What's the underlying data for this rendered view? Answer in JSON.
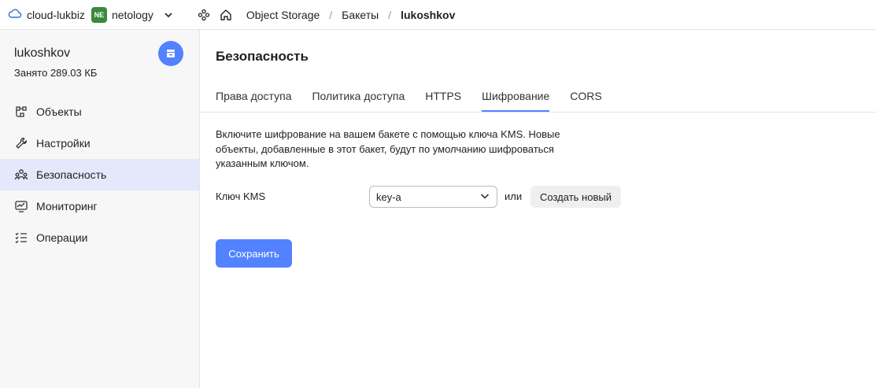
{
  "topbar": {
    "cloud_name": "cloud-lukbiz",
    "org_badge": "NE",
    "org_name": "netology",
    "breadcrumbs": [
      "Object Storage",
      "Бакеты",
      "lukoshkov"
    ]
  },
  "sidebar": {
    "bucket_name": "lukoshkov",
    "bucket_usage": "Занято 289.03 КБ",
    "items": [
      {
        "label": "Объекты",
        "icon": "objects-icon"
      },
      {
        "label": "Настройки",
        "icon": "wrench-icon"
      },
      {
        "label": "Безопасность",
        "icon": "users-icon",
        "selected": true
      },
      {
        "label": "Мониторинг",
        "icon": "monitor-icon"
      },
      {
        "label": "Операции",
        "icon": "list-icon"
      }
    ]
  },
  "main": {
    "title": "Безопасность",
    "tabs": [
      {
        "label": "Права доступа"
      },
      {
        "label": "Политика доступа"
      },
      {
        "label": "HTTPS"
      },
      {
        "label": "Шифрование",
        "selected": true
      },
      {
        "label": "CORS"
      }
    ],
    "description": "Включите шифрование на вашем бакете с помощью ключа KMS. Новые объекты, добавленные в этот бакет, будут по умолчанию шифроваться указанным ключом.",
    "kms_label": "Ключ KMS",
    "kms_value": "key-a",
    "or_text": "или",
    "create_label": "Создать новый",
    "save_label": "Сохранить"
  },
  "colors": {
    "accent": "#5282ff",
    "selected_nav_bg": "#e3e9fb",
    "org_badge_bg": "#3a8a3e"
  }
}
